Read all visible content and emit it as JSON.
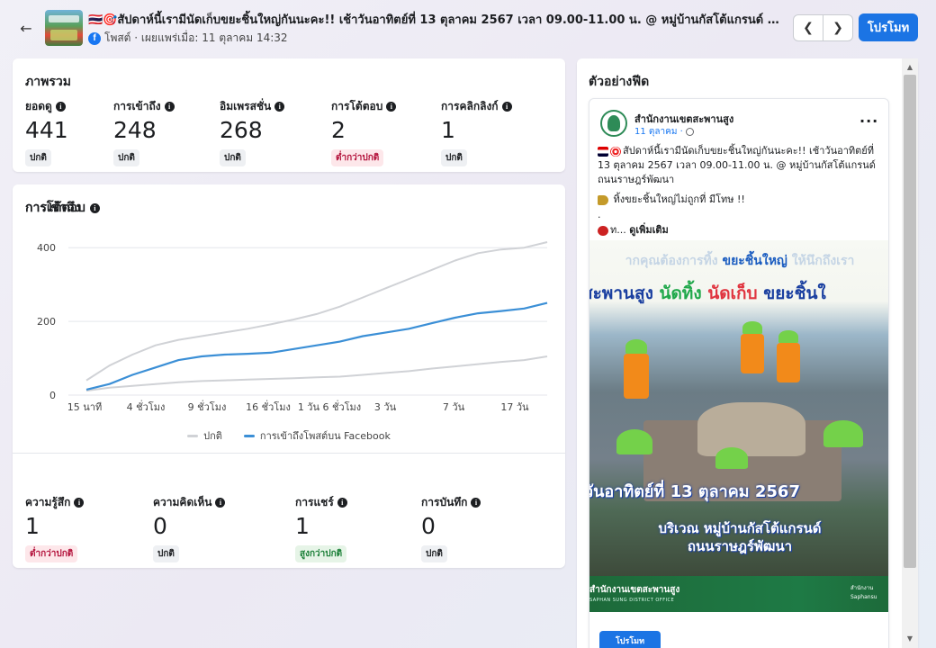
{
  "header": {
    "title": "🇹🇭🎯สัปดาห์นี้เรามีนัดเก็บขยะชิ้นใหญ่กันนะคะ!! เช้าวันอาทิตย์ที่ 13 ตุลาคม 2567 เวลา 09.00-11.00 น. @ หมู่บ้านกัสโต้แกรนด์ ถ...",
    "meta": "โพสต์ · เผยแพร่เมื่อ: 11 ตุลาคม 14:32",
    "promote_label": "โปรโมท"
  },
  "overview": {
    "title": "ภาพรวม",
    "metrics": [
      {
        "label": "ยอดดู",
        "value": "441",
        "badge": "ปกติ",
        "status": "normal"
      },
      {
        "label": "การเข้าถึง",
        "value": "248",
        "badge": "ปกติ",
        "status": "normal"
      },
      {
        "label": "อิมเพรสชั่น",
        "value": "268",
        "badge": "ปกติ",
        "status": "normal"
      },
      {
        "label": "การโต้ตอบ",
        "value": "2",
        "badge": "ต่ำกว่าปกติ",
        "status": "low"
      },
      {
        "label": "การคลิกลิงก์",
        "value": "1",
        "badge": "ปกติ",
        "status": "normal"
      }
    ]
  },
  "reach": {
    "title": "การเข้าถึง",
    "legend": [
      "ปกติ",
      "การเข้าถึงโพสต์บน Facebook"
    ]
  },
  "chart_data": {
    "type": "line",
    "title": "การเข้าถึง",
    "ylim": [
      0,
      420
    ],
    "yticks": [
      0,
      200,
      400
    ],
    "xtick_labels": [
      "15 นาที",
      "4 ชั่วโมง",
      "9 ชั่วโมง",
      "16 ชั่วโมง",
      "1 วัน 6 ชั่วโมง",
      "3 วัน",
      "7 วัน",
      "17 วัน"
    ],
    "grid": true,
    "legend_placement": "bottom",
    "series": [
      {
        "name": "ปกติ",
        "band": "upper",
        "color": "#d0d2d6",
        "values": [
          40,
          80,
          110,
          135,
          150,
          160,
          170,
          180,
          192,
          205,
          220,
          240,
          265,
          290,
          315,
          340,
          365,
          385,
          395,
          400,
          415
        ]
      },
      {
        "name": "ปกติ",
        "band": "lower",
        "color": "#d0d2d6",
        "values": [
          12,
          20,
          25,
          30,
          35,
          38,
          40,
          42,
          44,
          46,
          48,
          50,
          55,
          60,
          65,
          72,
          78,
          84,
          90,
          95,
          105
        ]
      },
      {
        "name": "การเข้าถึงโพสต์บน Facebook",
        "color": "#3b8fd6",
        "values": [
          15,
          30,
          55,
          75,
          95,
          105,
          110,
          112,
          115,
          125,
          135,
          145,
          160,
          170,
          180,
          195,
          210,
          222,
          228,
          235,
          250
        ]
      }
    ]
  },
  "engagement": {
    "title": "การโต้ตอบ",
    "metrics": [
      {
        "label": "ความรู้สึก",
        "value": "1",
        "badge": "ต่ำกว่าปกติ",
        "status": "low"
      },
      {
        "label": "ความคิดเห็น",
        "value": "0",
        "badge": "ปกติ",
        "status": "normal"
      },
      {
        "label": "การแชร์",
        "value": "1",
        "badge": "สูงกว่าปกติ",
        "status": "high"
      },
      {
        "label": "การบันทึก",
        "value": "0",
        "badge": "ปกติ",
        "status": "normal"
      }
    ]
  },
  "feed": {
    "title": "ตัวอย่างฟีด",
    "page_name": "สำนักงานเขตสะพานสูง",
    "date": "11 ตุลาคม ·",
    "text_line1": "สัปดาห์นี้เรามีนัดเก็บขยะชิ้นใหญ่กันนะคะ!! เช้าวันอาทิตย์ที่ 13 ตุลาคม 2567 เวลา 09.00-11.00 น. @ หมู่บ้านกัสโต้แกรนด์ ถนนราษฎร์พัฒนา",
    "text_line2": "ทิ้งขยะชิ้นใหญ่ไม่ถูกที่ มีโทษ !!",
    "text_dot": ".",
    "text_line3": "ท... ",
    "see_more": "ดูเพิ่มเติม",
    "image": {
      "line1_pre": "ากคุณต้องการทิ้ง ",
      "line1_bold": "ขยะชิ้นใหญ่",
      "line1_post": " ให้นึกถึงเรา",
      "line2_a": "สะพานสูง ",
      "line2_b": "นัดทิ้ง ",
      "line2_c": "นัดเก็บ ",
      "line2_d": "ขยะชิ้นใ",
      "line3": "วันอาทิตย์ที่ 13 ตุลาคม 2567",
      "line4a": "บริเวณ หมู่บ้านกัสโต้แกรนด์",
      "line4b": "ถนนราษฎร์พัฒนา",
      "footer_name": "สำนักงานเขตสะพานสูง",
      "footer_sub": "SAPHAN SUNG DISTRICT OFFICE",
      "footer_r1": "สำนักงาน",
      "footer_r2": "Saphansu"
    },
    "cta_label": "โปรโมท"
  }
}
